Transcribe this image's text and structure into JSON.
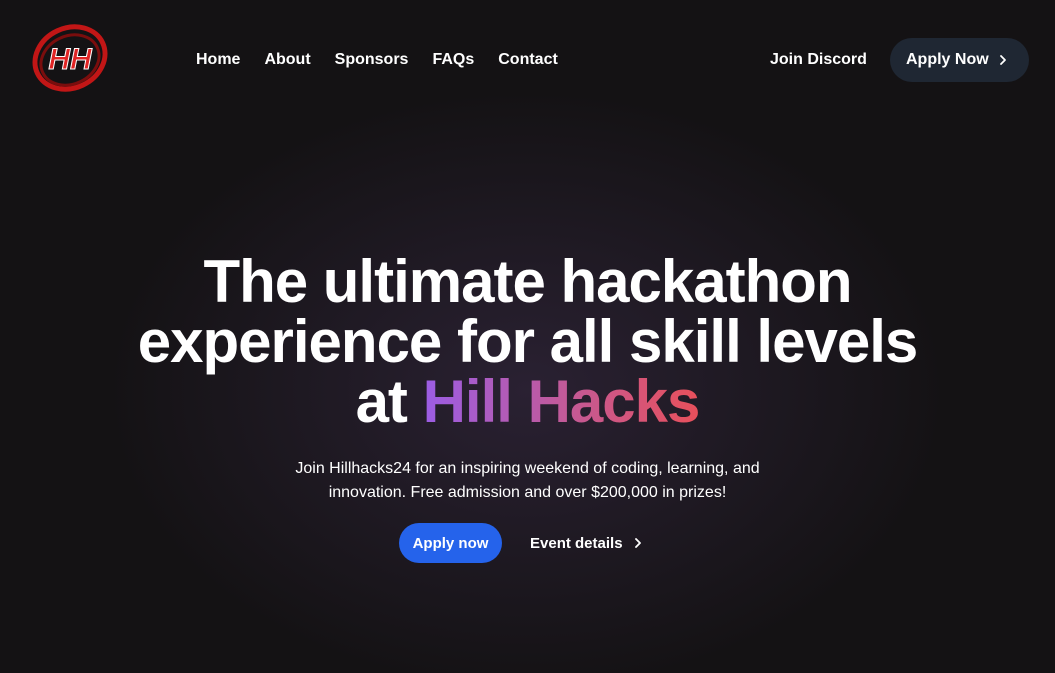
{
  "header": {
    "logo_text": "HH",
    "nav": [
      {
        "label": "Home"
      },
      {
        "label": "About"
      },
      {
        "label": "Sponsors"
      },
      {
        "label": "FAQs"
      },
      {
        "label": "Contact"
      }
    ],
    "discord_label": "Join Discord",
    "apply_label": "Apply Now"
  },
  "hero": {
    "title_line1": "The ultimate hackathon",
    "title_line2": "experience for all skill levels",
    "title_line3_prefix": "at ",
    "title_highlight": "Hill Hacks",
    "subtitle_line1": "Join Hillhacks24 for an inspiring weekend of coding, learning, and",
    "subtitle_line2": "innovation. Free admission and over $200,000 in prizes!",
    "primary_cta": "Apply now",
    "secondary_cta": "Event details"
  },
  "colors": {
    "background": "#141214",
    "primary_button": "#2563eb",
    "header_button": "#1f2733",
    "gradient_start": "#9b5de5",
    "gradient_end": "#e8505b",
    "logo_red": "#d81e1e"
  },
  "icons": {
    "header_apply_icon": "chevron-right-icon",
    "event_details_icon": "chevron-right-icon"
  }
}
